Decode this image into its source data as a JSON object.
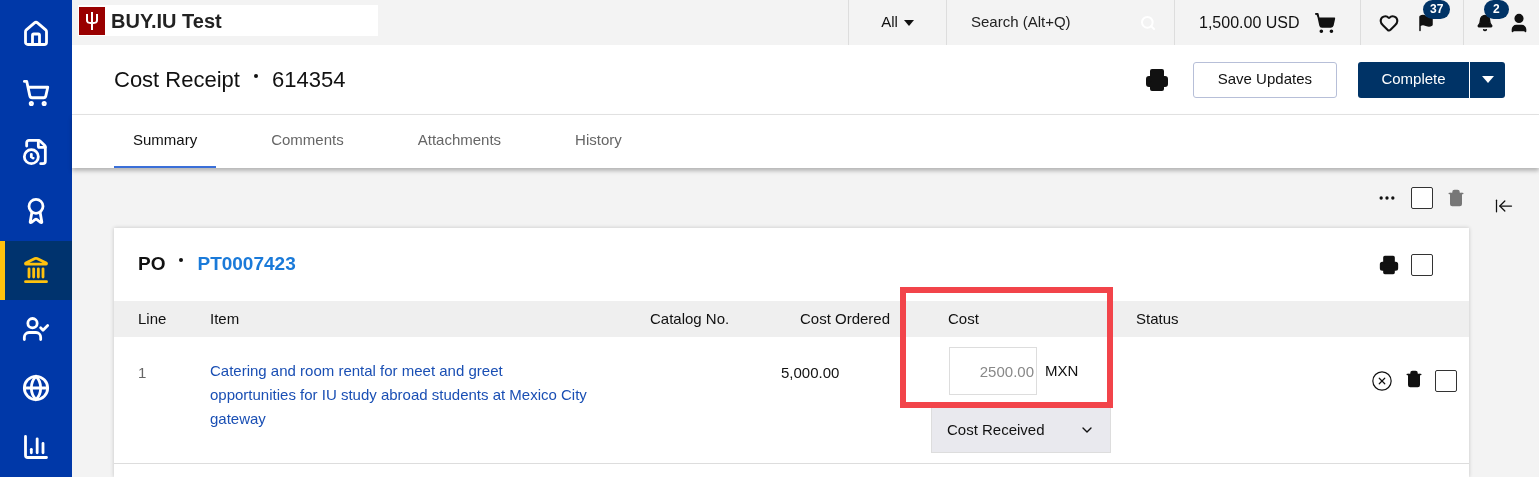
{
  "sidebar": {
    "items": [
      {
        "selected": false
      },
      {
        "selected": false
      },
      {
        "selected": false
      },
      {
        "selected": false
      },
      {
        "selected": true
      },
      {
        "selected": false
      },
      {
        "selected": false
      },
      {
        "selected": false
      }
    ]
  },
  "topbar": {
    "logo_text": "BUY.IU Test",
    "scope": "All",
    "search": {
      "placeholder": "Search (Alt+Q)"
    },
    "cart_total": "1,500.00 USD",
    "flag_badge": "37",
    "bell_badge": "2"
  },
  "header": {
    "title": "Cost Receipt",
    "number": "614354",
    "buttons": [
      "Save Updates",
      "Complete"
    ]
  },
  "tabs": [
    {
      "label": "Summary",
      "selected": true
    },
    {
      "label": "Comments",
      "selected": false
    },
    {
      "label": "Attachments",
      "selected": false
    },
    {
      "label": "History",
      "selected": false
    }
  ],
  "bulk": {
    "checked": false
  },
  "po": {
    "label": "PO",
    "number": "PT0007423",
    "checked": false,
    "table": {
      "columns": [
        "Line",
        "Item",
        "Catalog No.",
        "Cost Ordered",
        "Cost",
        "Status"
      ],
      "rows": [
        {
          "line": "1",
          "item": "Catering and room rental for meet and greet opportunities for IU study abroad students at Mexico City gateway",
          "cost_ordered": "5,000.00",
          "cost": {
            "placeholder": "2500.00"
          },
          "currency": "MXN",
          "status": "Cost Received",
          "checked": false
        }
      ]
    }
  }
}
